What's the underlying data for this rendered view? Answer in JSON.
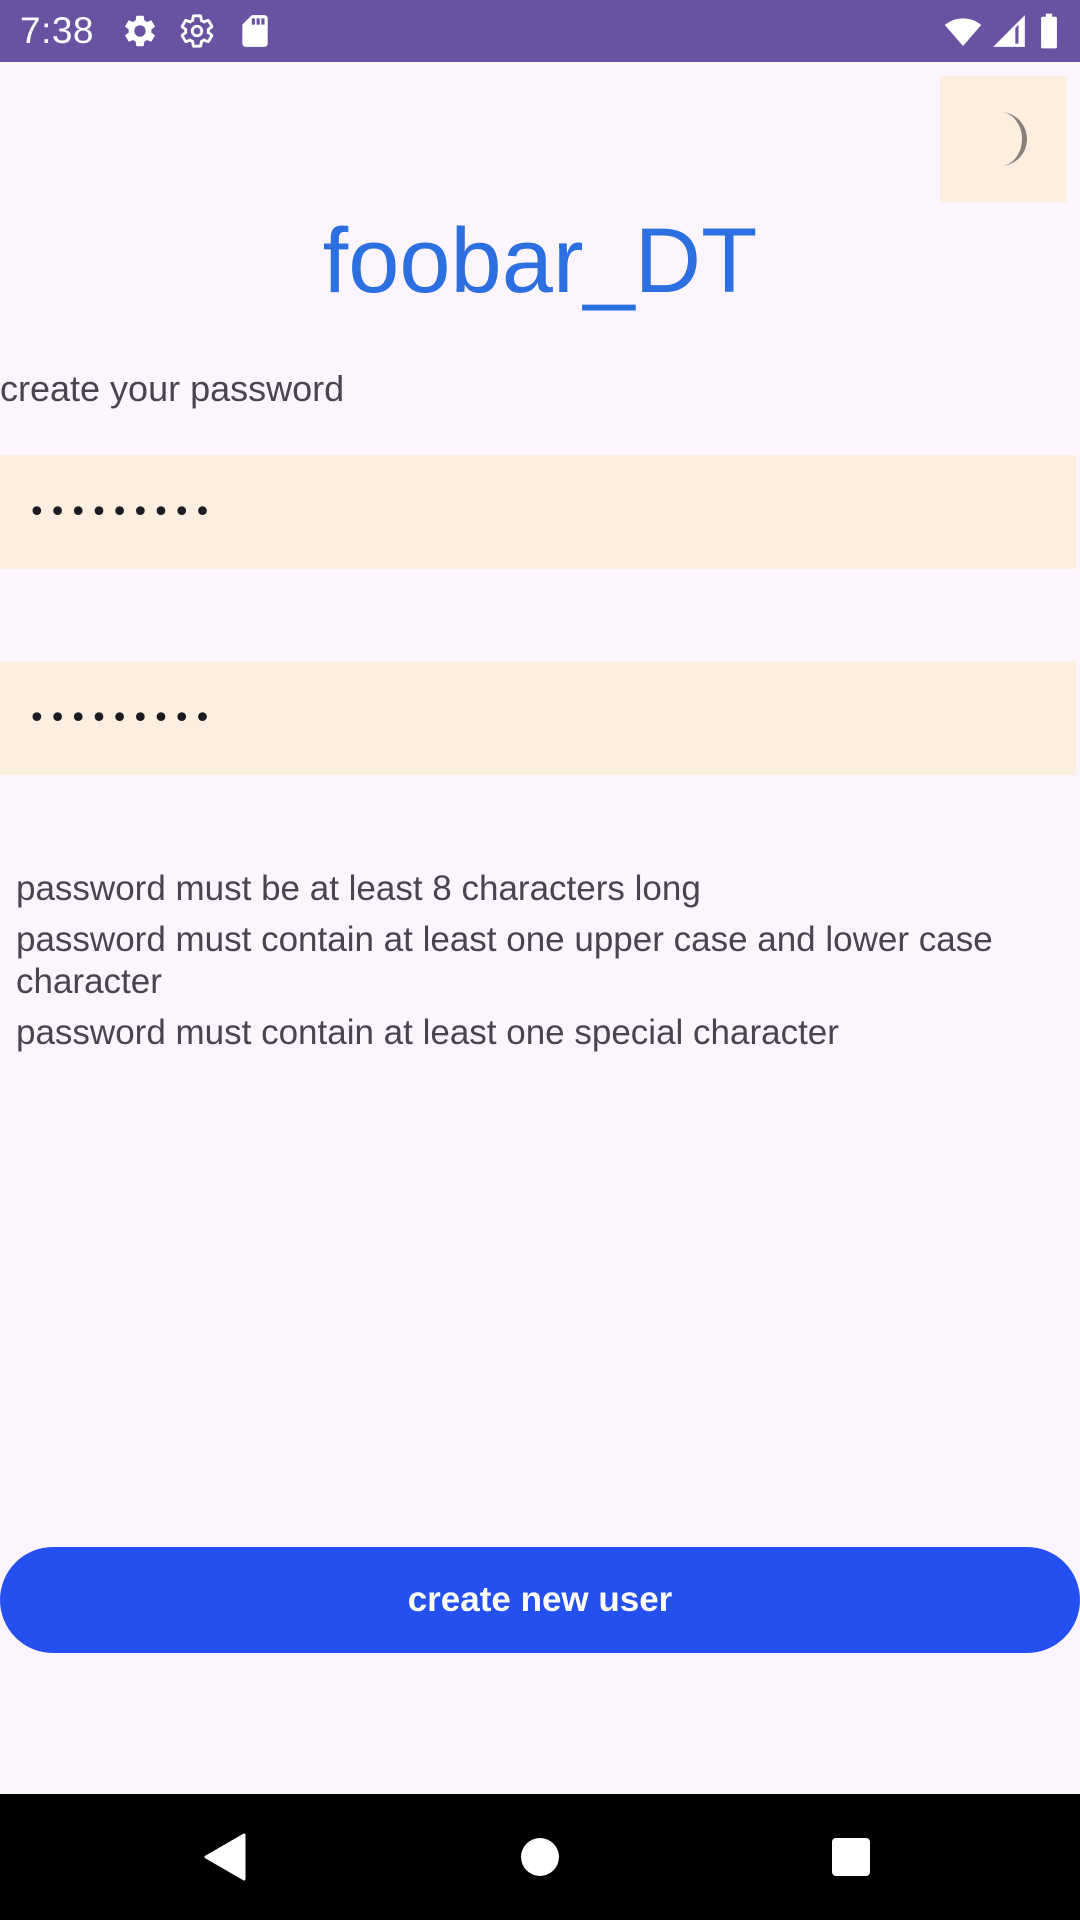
{
  "status_bar": {
    "time": "7:38",
    "left_icons": [
      "gear-icon",
      "gear-outline-icon",
      "sd-card-icon"
    ],
    "right_icons": [
      "wifi-icon",
      "cell-signal-icon",
      "battery-icon"
    ],
    "background": "#6a52a3"
  },
  "theme_toggle": {
    "icon": "moon-icon",
    "background": "#fdefdf"
  },
  "header": {
    "title": "foobar_DT",
    "title_color": "#2b6fe0"
  },
  "form": {
    "label": "create your password",
    "password_value": "•••••••••",
    "confirm_password_value": "•••••••••",
    "field_background": "#fdefdf"
  },
  "requirements": [
    "password must be at least 8 characters long",
    "password must contain at least one upper case and lower case character",
    "password must contain at least one special character"
  ],
  "actions": {
    "create_label": "create new user",
    "button_color": "#2450ef"
  },
  "nav_bar": {
    "buttons": [
      "back-icon",
      "home-icon",
      "recents-icon"
    ]
  }
}
